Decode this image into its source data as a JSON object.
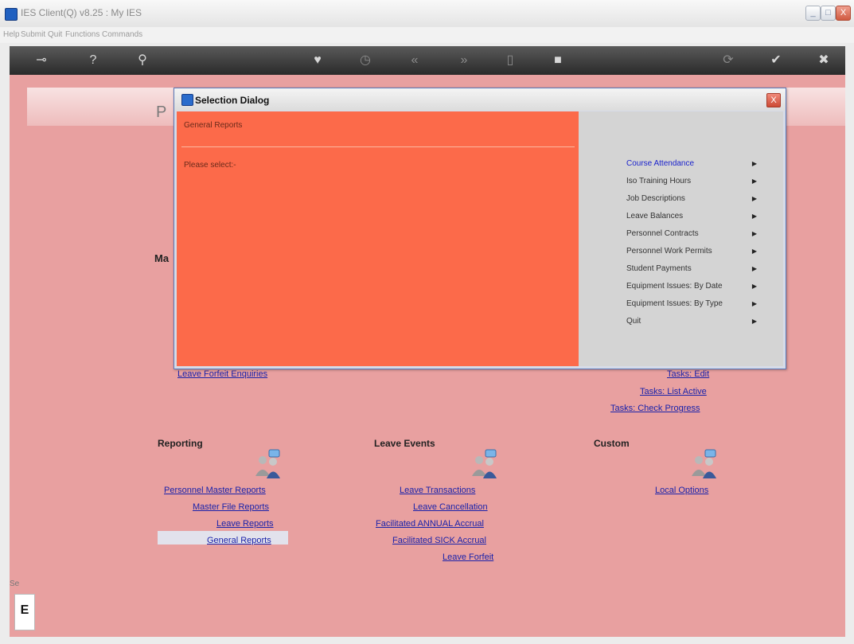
{
  "window": {
    "title": "IES Client(Q) v8.25 : My IES",
    "controls": {
      "minimize": "_",
      "maximize": "□",
      "close": "X"
    }
  },
  "menubar": {
    "items": [
      "Help",
      "Submit",
      "Quit",
      "Functions",
      "Commands"
    ]
  },
  "toolbar": {
    "tools": [
      {
        "name": "key-icon",
        "glyph": "⊸"
      },
      {
        "name": "help-icon",
        "glyph": "?"
      },
      {
        "name": "search-icon",
        "glyph": "⚲"
      },
      {
        "name": "heart-icon",
        "glyph": "♥"
      },
      {
        "name": "clock-icon",
        "glyph": "◷"
      },
      {
        "name": "rewind-icon",
        "glyph": "«"
      },
      {
        "name": "forward-icon",
        "glyph": "»"
      },
      {
        "name": "document-icon",
        "glyph": "▯"
      },
      {
        "name": "stop-icon",
        "glyph": "■"
      },
      {
        "name": "refresh-icon",
        "glyph": "⟳"
      },
      {
        "name": "check-icon",
        "glyph": "✔"
      },
      {
        "name": "cancel-icon",
        "glyph": "✖"
      }
    ]
  },
  "page": {
    "title_partial": "P",
    "side_label_partial": "Ma"
  },
  "links_top": {
    "leave_forfeit_enquiries": "Leave Forfeit Enquiries",
    "tasks_edit": "Tasks: Edit",
    "tasks_list_active": "Tasks: List Active",
    "tasks_check_progress": "Tasks: Check Progress"
  },
  "sections": {
    "reporting": {
      "title": "Reporting",
      "links": [
        "Personnel Master Reports",
        "Master File Reports",
        "Leave Reports",
        "General Reports"
      ]
    },
    "leave_events": {
      "title": "Leave Events",
      "links": [
        "Leave Transactions",
        "Leave Cancellation",
        "Facilitated ANNUAL Accrual",
        "Facilitated SICK Accrual",
        "Leave Forfeit"
      ]
    },
    "custom": {
      "title": "Custom",
      "links": [
        "Local Options"
      ]
    }
  },
  "statusbar": {
    "label_partial": "Se",
    "box_partial": "E"
  },
  "dialog": {
    "title": "Selection Dialog",
    "heading": "General Reports",
    "prompt": "Please select:-",
    "options": [
      "Course Attendance",
      "Iso Training Hours",
      "Job Descriptions",
      "Leave Balances",
      "Personnel Contracts",
      "Personnel Work Permits",
      "Student Payments",
      "Equipment Issues: By Date",
      "Equipment Issues: By Type",
      "Quit"
    ],
    "active_option": "Course Attendance",
    "option_arrow": "▶"
  },
  "colors": {
    "content_bg": "#e8a0a0",
    "dialog_left_bg": "#fc6a4a",
    "dialog_right_bg": "#d4d4d4",
    "link_color": "#1a22aa",
    "toolbar_bg": "#3a3a3a"
  }
}
